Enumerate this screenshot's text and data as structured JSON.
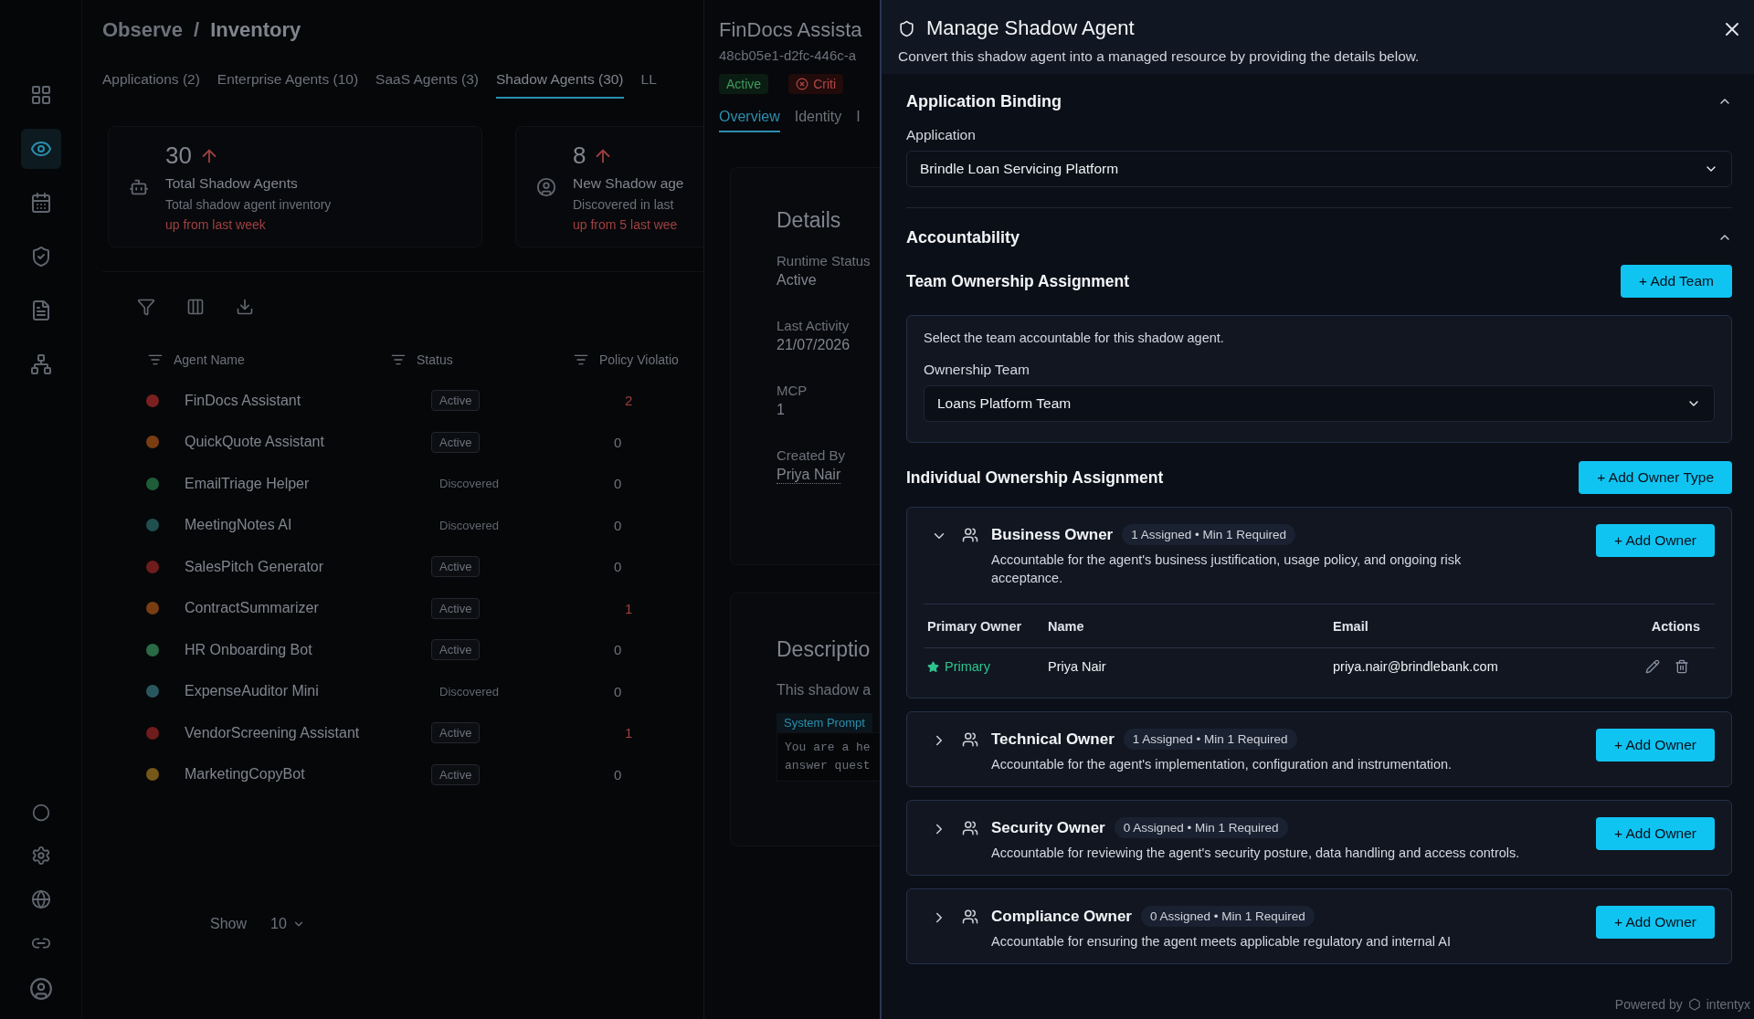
{
  "sidebar": {
    "items": [
      {
        "selected": false
      },
      {
        "selected": true
      },
      {
        "selected": false
      },
      {
        "selected": false
      },
      {
        "selected": false
      },
      {
        "selected": false
      }
    ]
  },
  "breadcrumb": {
    "items": [
      "Observe",
      "Inventory"
    ],
    "separator": "/"
  },
  "tabs": [
    {
      "label": "Applications (2)",
      "selected": false
    },
    {
      "label": "Enterprise Agents (10)",
      "selected": false
    },
    {
      "label": "SaaS Agents (3)",
      "selected": false
    },
    {
      "label": "Shadow Agents (30)",
      "selected": true
    },
    {
      "label": "LL",
      "selected": false
    }
  ],
  "stats": [
    {
      "value": "30",
      "title": "Total Shadow Agents",
      "description": "Total shadow agent inventory",
      "trend": "up from last week"
    },
    {
      "value": "8",
      "title": "New Shadow age",
      "description": "Discovered in last",
      "trend": "up from 5 last wee"
    }
  ],
  "table": {
    "columns": [
      "Agent Name",
      "Status",
      "Policy Violatio"
    ],
    "rows": [
      {
        "name": "FinDocs Assistant",
        "color": "#7a2020",
        "status": {
          "label": "Active",
          "kind": "active"
        },
        "violations": "2",
        "flagged": true
      },
      {
        "name": "QuickQuote Assistant",
        "color": "#7a3d12",
        "status": {
          "label": "Active",
          "kind": "active"
        },
        "violations": "0",
        "flagged": false
      },
      {
        "name": "EmailTriage Helper",
        "color": "#1f5c3a",
        "status": {
          "label": "Discovered",
          "kind": "discovered"
        },
        "violations": "0",
        "flagged": false
      },
      {
        "name": "MeetingNotes AI",
        "color": "#1f4f4f",
        "status": {
          "label": "Discovered",
          "kind": "discovered"
        },
        "violations": "0",
        "flagged": false
      },
      {
        "name": "SalesPitch Generator",
        "color": "#6e1c1c",
        "status": {
          "label": "Active",
          "kind": "active"
        },
        "violations": "0",
        "flagged": false
      },
      {
        "name": "ContractSummarizer",
        "color": "#7a3d12",
        "status": {
          "label": "Active",
          "kind": "active"
        },
        "violations": "1",
        "flagged": true
      },
      {
        "name": "HR Onboarding Bot",
        "color": "#286b45",
        "status": {
          "label": "Active",
          "kind": "active"
        },
        "violations": "0",
        "flagged": false
      },
      {
        "name": "ExpenseAuditor Mini",
        "color": "#2a575d",
        "status": {
          "label": "Discovered",
          "kind": "discovered"
        },
        "violations": "0",
        "flagged": false
      },
      {
        "name": "VendorScreening Assistant",
        "color": "#6e1c1c",
        "status": {
          "label": "Active",
          "kind": "active"
        },
        "violations": "1",
        "flagged": true
      },
      {
        "name": "MarketingCopyBot",
        "color": "#76571a",
        "status": {
          "label": "Active",
          "kind": "active"
        },
        "violations": "0",
        "flagged": false
      }
    ]
  },
  "pagination": {
    "label": "Show",
    "value": "10"
  },
  "detail": {
    "title": "FinDocs Assista",
    "id": "48cb05e1-d2fc-446c-a",
    "badges": [
      {
        "label": "Active",
        "kind": "success"
      },
      {
        "label": "Criti",
        "kind": "danger"
      }
    ],
    "tabs": [
      {
        "label": "Overview",
        "selected": true
      },
      {
        "label": "Identity",
        "selected": false
      },
      {
        "label": "I",
        "selected": false
      }
    ],
    "details_title": "Details",
    "fields": [
      {
        "label": "Runtime Status",
        "value": "Active",
        "kind": "text"
      },
      {
        "label": "Last Activity",
        "value": "21/07/2026",
        "kind": "text"
      },
      {
        "label": "MCP",
        "value": "1",
        "kind": "text"
      },
      {
        "label": "Created By",
        "value": "Priya Nair",
        "kind": "link"
      }
    ],
    "description": {
      "title": "Descriptio",
      "text": "This shadow a",
      "prompt_label": "System Prompt",
      "prompt_lines": [
        "You are a he",
        "answer quest"
      ]
    }
  },
  "drawer": {
    "title": "Manage Shadow Agent",
    "subtitle": "Convert this shadow agent into a managed resource by providing the details below.",
    "application_binding": {
      "title": "Application Binding",
      "expanded": true,
      "label": "Application",
      "value": "Brindle Loan Servicing Platform"
    },
    "accountability": {
      "title": "Accountability",
      "expanded": true,
      "team": {
        "title": "Team Ownership Assignment",
        "button": "+ Add Team",
        "hint": "Select the team accountable for this shadow agent.",
        "label": "Ownership Team",
        "value": "Loans Platform Team"
      },
      "individual": {
        "title": "Individual Ownership Assignment",
        "button": "+ Add Owner Type",
        "owner_types": [
          {
            "title": "Business Owner",
            "badge": "1 Assigned • Min 1 Required",
            "description": "Accountable for the agent's business justification, usage policy, and ongoing risk acceptance.",
            "button": "+ Add Owner",
            "expanded": true,
            "columns": [
              "Primary Owner",
              "Name",
              "Email",
              "Actions"
            ],
            "owners": [
              {
                "primary": true,
                "primary_label": "Primary",
                "name": "Priya Nair",
                "email": "priya.nair@brindlebank.com"
              }
            ]
          },
          {
            "title": "Technical Owner",
            "badge": "1 Assigned • Min 1 Required",
            "description": "Accountable for the agent's implementation, configuration and instrumentation.",
            "button": "+ Add Owner",
            "expanded": false
          },
          {
            "title": "Security Owner",
            "badge": "0 Assigned • Min 1 Required",
            "description": "Accountable for reviewing the agent's security posture, data handling and access controls.",
            "button": "+ Add Owner",
            "expanded": false
          },
          {
            "title": "Compliance Owner",
            "badge": "0 Assigned • Min 1 Required",
            "description": "Accountable for ensuring the agent meets applicable regulatory and internal AI",
            "button": "+ Add Owner",
            "expanded": false
          }
        ]
      }
    }
  },
  "footer": {
    "powered_by": "Powered by",
    "brand": "intentyx"
  }
}
